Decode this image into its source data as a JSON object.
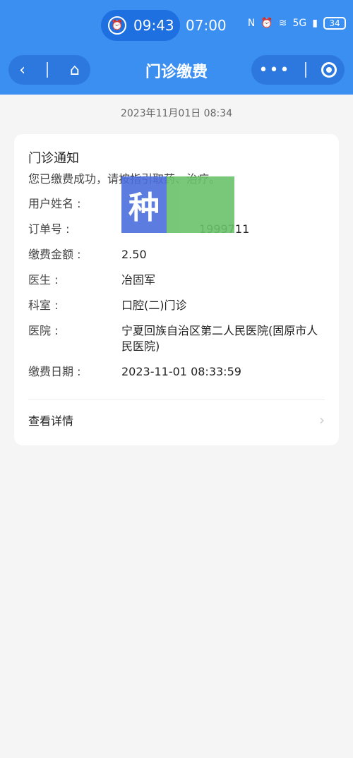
{
  "status_bar": {
    "time_pill": "09:43",
    "time_main": "07:00",
    "network": "5G",
    "battery": "34"
  },
  "nav": {
    "title": "门诊缴费"
  },
  "timestamp": "2023年11月01日 08:34",
  "card": {
    "title": "门诊通知",
    "subtitle": "您已缴费成功，请按指引取药、治疗。",
    "rows": [
      {
        "label": "用户姓名 :",
        "value": ""
      },
      {
        "label": "订单号    :",
        "value": "1999711"
      },
      {
        "label": "缴费金额 :",
        "value": "2.50"
      },
      {
        "label": "医生        :",
        "value": "冶固军"
      },
      {
        "label": "科室        :",
        "value": "口腔(二)门诊"
      },
      {
        "label": "医院        :",
        "value": "宁夏回族自治区第二人民医院(固原市人民医院)"
      },
      {
        "label": "缴费日期 :",
        "value": "2023-11-01 08:33:59"
      }
    ],
    "detail_label": "查看详情"
  },
  "sticker_text": "种"
}
